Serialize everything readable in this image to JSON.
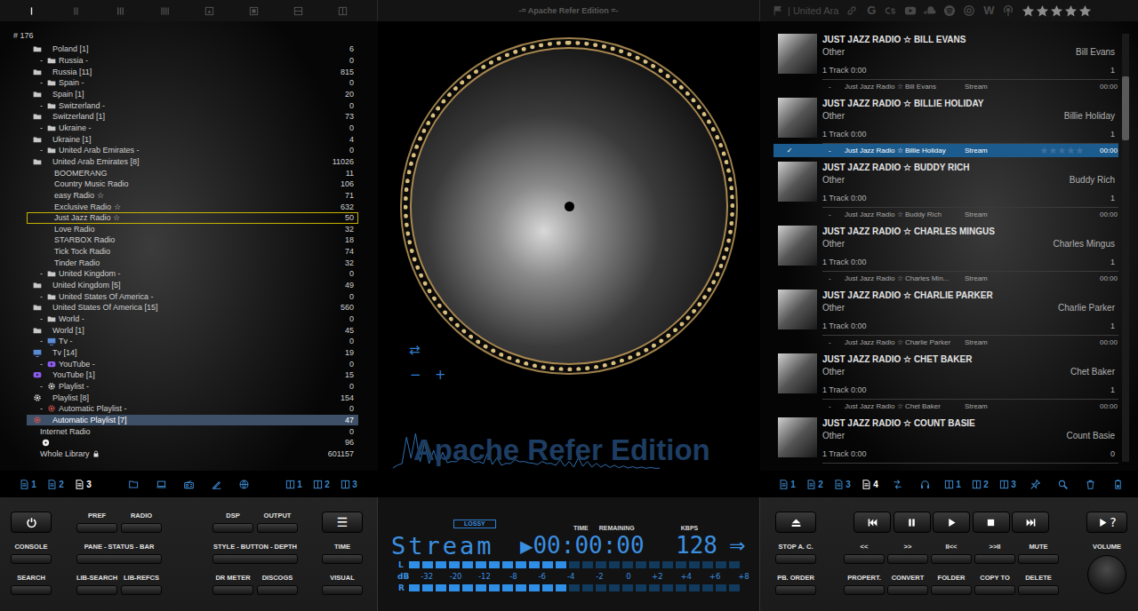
{
  "window": {
    "title": "-= Apache Refer Edition =-"
  },
  "top_bar": {
    "layouts": [
      {
        "selected": true
      },
      {
        "selected": false
      },
      {
        "selected": false
      },
      {
        "selected": false
      },
      {
        "selected": false
      },
      {
        "selected": false
      },
      {
        "selected": false
      },
      {
        "selected": false
      }
    ],
    "location": "| United Ara",
    "google": "G",
    "wiki": "W",
    "rating": {
      "stars": 0
    }
  },
  "library": {
    "header": "# 176",
    "rows": [
      {
        "label": "Poland [1]",
        "count": "6",
        "kind": "country",
        "nested": false,
        "selected": false,
        "focused": false
      },
      {
        "expander": "-",
        "label": "Russia -",
        "count": "0",
        "kind": "country",
        "nested": true,
        "selected": false,
        "focused": false
      },
      {
        "label": "Russia [11]",
        "count": "815",
        "kind": "country",
        "nested": false,
        "selected": false,
        "focused": false
      },
      {
        "expander": "-",
        "label": "Spain -",
        "count": "0",
        "kind": "country",
        "nested": true,
        "selected": false,
        "focused": false
      },
      {
        "label": "Spain [1]",
        "count": "20",
        "kind": "country",
        "nested": false,
        "selected": false,
        "focused": false
      },
      {
        "expander": "-",
        "label": "Switzerland -",
        "count": "0",
        "kind": "country",
        "nested": true,
        "selected": false,
        "focused": false
      },
      {
        "label": "Switzerland [1]",
        "count": "73",
        "kind": "country",
        "nested": false,
        "selected": false,
        "focused": false
      },
      {
        "expander": "-",
        "label": "Ukraine -",
        "count": "0",
        "kind": "country",
        "nested": true,
        "selected": false,
        "focused": false
      },
      {
        "label": "Ukraine [1]",
        "count": "4",
        "kind": "country",
        "nested": false,
        "selected": false,
        "focused": false
      },
      {
        "expander": "-",
        "label": "United Arab Emirates -",
        "count": "0",
        "kind": "country",
        "nested": true,
        "selected": false,
        "focused": false
      },
      {
        "label": "United Arab Emirates [8]",
        "count": "11026",
        "kind": "country",
        "nested": false,
        "selected": false,
        "focused": false
      },
      {
        "label": "BOOMERANG",
        "count": "11",
        "kind": "station",
        "nested": false,
        "selected": false,
        "focused": false
      },
      {
        "label": "Country Music Radio",
        "count": "106",
        "kind": "station",
        "nested": false,
        "selected": false,
        "focused": false
      },
      {
        "label": "easy Radio ☆",
        "count": "71",
        "kind": "station",
        "nested": false,
        "selected": false,
        "focused": false
      },
      {
        "label": "Exclusive Radio ☆",
        "count": "632",
        "kind": "station",
        "nested": false,
        "selected": false,
        "focused": false
      },
      {
        "label": "Just Jazz Radio ☆",
        "count": "50",
        "kind": "station",
        "nested": false,
        "selected": false,
        "focused": true
      },
      {
        "label": "Love Radio",
        "count": "32",
        "kind": "station",
        "nested": false,
        "selected": false,
        "focused": false
      },
      {
        "label": "STARBOX Radio",
        "count": "18",
        "kind": "station",
        "nested": false,
        "selected": false,
        "focused": false
      },
      {
        "label": "Tick Tock Radio",
        "count": "74",
        "kind": "station",
        "nested": false,
        "selected": false,
        "focused": false
      },
      {
        "label": "Tinder Radio",
        "count": "32",
        "kind": "station",
        "nested": false,
        "selected": false,
        "focused": false
      },
      {
        "expander": "-",
        "label": "United Kingdom -",
        "count": "0",
        "kind": "country",
        "nested": true,
        "selected": false,
        "focused": false
      },
      {
        "label": "United Kingdom [5]",
        "count": "49",
        "kind": "country",
        "nested": false,
        "selected": false,
        "focused": false
      },
      {
        "expander": "-",
        "label": "United States Of America -",
        "count": "0",
        "kind": "country",
        "nested": true,
        "selected": false,
        "focused": false
      },
      {
        "label": "United States Of America [15]",
        "count": "560",
        "kind": "country",
        "nested": false,
        "selected": false,
        "focused": false
      },
      {
        "expander": "-",
        "label": "World -",
        "count": "0",
        "kind": "country",
        "nested": true,
        "selected": false,
        "focused": false
      },
      {
        "label": "World [1]",
        "count": "45",
        "kind": "country",
        "nested": false,
        "selected": false,
        "focused": false
      },
      {
        "expander": "-",
        "label": "Tv -",
        "count": "0",
        "kind": "tv",
        "nested": true,
        "selected": false,
        "focused": false
      },
      {
        "label": "Tv [14]",
        "count": "19",
        "kind": "tv",
        "nested": false,
        "selected": false,
        "focused": false
      },
      {
        "expander": "-",
        "label": "YouTube -",
        "count": "0",
        "kind": "youtube",
        "nested": true,
        "selected": false,
        "focused": false
      },
      {
        "label": "YouTube [1]",
        "count": "15",
        "kind": "youtube",
        "nested": false,
        "selected": false,
        "focused": false
      },
      {
        "expander": "-",
        "label": "Playlist -",
        "count": "0",
        "kind": "playlist",
        "nested": true,
        "selected": false,
        "focused": false
      },
      {
        "label": "Playlist [8]",
        "count": "154",
        "kind": "playlist",
        "nested": false,
        "selected": false,
        "focused": false
      },
      {
        "expander": "-",
        "label": "Automatic Playlist -",
        "count": "0",
        "kind": "autoplaylist",
        "nested": true,
        "selected": false,
        "focused": false
      },
      {
        "label": "Automatic Playlist [7]",
        "count": "47",
        "kind": "autoplaylist",
        "nested": false,
        "selected": true,
        "focused": false
      },
      {
        "label": "Internet Radio",
        "count": "0",
        "kind": "source",
        "nested": false,
        "selected": false,
        "focused": false
      },
      {
        "count": "96",
        "kind": "disc",
        "nested": false,
        "selected": false,
        "focused": false
      },
      {
        "label": "Whole Library",
        "count": "601157",
        "kind": "source",
        "nested": false,
        "locked": true,
        "selected": false,
        "focused": false
      }
    ]
  },
  "cover": {
    "shuffle": "⇄",
    "minus": "−",
    "plus": "+"
  },
  "waveform": [
    0.05,
    0.1,
    0.3,
    0.85,
    0.6,
    0.95,
    0.4,
    0.7,
    0.3,
    0.5,
    0.25,
    0.45,
    0.35,
    0.2,
    0.4,
    0.3,
    0.55,
    0.25,
    0.35,
    0.2,
    0.3,
    0.45,
    0.25,
    0.3,
    0.2,
    0.15,
    0.3,
    0.25,
    0.4,
    0.2,
    0.35,
    0.15,
    0.25,
    0.2,
    0.3,
    0.15,
    0.2,
    0.25,
    0.15,
    0.2,
    0.1,
    0.3,
    0.15,
    0.2,
    0.1,
    0.15,
    0.1,
    0.12,
    0.08,
    0.1,
    0.06,
    0.08,
    0.05,
    0.06,
    0.04,
    0.05,
    0.03,
    0.04,
    0.03,
    0.02
  ],
  "brand": "Apache Refer Edition",
  "playlist": {
    "groups": [
      {
        "title": "JUST JAZZ RADIO ☆ BILL EVANS",
        "genre": "Other",
        "artist": "Bill Evans",
        "summary": "1 Track  0:00",
        "count": "1",
        "track": {
          "number": "-",
          "title": "Just Jazz Radio ☆ Bill Evans",
          "codec": "Stream",
          "time": "00:00",
          "selected": false
        }
      },
      {
        "title": "JUST JAZZ RADIO ☆ BILLIE HOLIDAY",
        "genre": "Other",
        "artist": "Billie Holiday",
        "summary": "1 Track  0:00",
        "count": "1",
        "track": {
          "check": "✓",
          "number": "-",
          "title": "Just Jazz Radio ☆ Billie Holiday",
          "codec": "Stream",
          "stars": 0,
          "time": "00:00",
          "selected": true
        }
      },
      {
        "title": "JUST JAZZ RADIO ☆ BUDDY RICH",
        "genre": "Other",
        "artist": "Buddy Rich",
        "summary": "1 Track  0:00",
        "count": "1",
        "track": {
          "number": "-",
          "title": "Just Jazz Radio ☆ Buddy Rich",
          "codec": "Stream",
          "time": "00:00",
          "selected": false
        }
      },
      {
        "title": "JUST JAZZ RADIO ☆ CHARLES MINGUS",
        "genre": "Other",
        "artist": "Charles Mingus",
        "summary": "1 Track  0:00",
        "count": "1",
        "track": {
          "number": "-",
          "title": "Just Jazz Radio ☆ Charles Min...",
          "codec": "Stream",
          "time": "00:00",
          "selected": false
        }
      },
      {
        "title": "JUST JAZZ RADIO ☆ CHARLIE PARKER",
        "genre": "Other",
        "artist": "Charlie Parker",
        "summary": "1 Track  0:00",
        "count": "1",
        "track": {
          "number": "-",
          "title": "Just Jazz Radio ☆ Charlie Parker",
          "codec": "Stream",
          "time": "00:00",
          "selected": false
        }
      },
      {
        "title": "JUST JAZZ RADIO ☆ CHET BAKER",
        "genre": "Other",
        "artist": "Chet Baker",
        "summary": "1 Track  0:00",
        "count": "1",
        "track": {
          "number": "-",
          "title": "Just Jazz Radio ☆ Chet Baker",
          "codec": "Stream",
          "time": "00:00",
          "selected": false
        }
      },
      {
        "title": "JUST JAZZ RADIO ☆ COUNT BASIE",
        "genre": "Other",
        "artist": "Count Basie",
        "summary": "1 Track  0:00",
        "count": "0"
      }
    ],
    "scrollbar": {
      "position": 0.1,
      "size": 0.15
    }
  },
  "left_strip": {
    "pages": [
      {
        "label": "1",
        "selected": false
      },
      {
        "label": "2",
        "selected": false
      },
      {
        "label": "3",
        "selected": true
      }
    ],
    "views": [
      {
        "label": "1",
        "selected": false
      },
      {
        "label": "2",
        "selected": false
      },
      {
        "label": "3",
        "selected": false
      }
    ]
  },
  "right_strip": {
    "pages": [
      {
        "label": "1",
        "selected": false
      },
      {
        "label": "2",
        "selected": false
      },
      {
        "label": "3",
        "selected": false
      },
      {
        "label": "4",
        "selected": true
      }
    ],
    "views": [
      {
        "label": "1",
        "selected": false
      },
      {
        "label": "2",
        "selected": false
      },
      {
        "label": "3",
        "selected": false
      }
    ]
  },
  "controls": {
    "left": {
      "a": [
        "CONSOLE",
        "SEARCH"
      ],
      "b": [
        [
          "PREF",
          "RADIO"
        ],
        [
          "PANE - STATUS - BAR"
        ],
        [
          "LIB-SEARCH",
          "LIB-REFCS"
        ]
      ],
      "c": [
        [
          "DSP",
          "OUTPUT"
        ],
        [
          "STYLE - BUTTON - DEPTH"
        ],
        [
          "DR METER",
          "DISCOGS"
        ]
      ],
      "menu": "☰",
      "d": [
        "TIME",
        "VISUAL"
      ]
    },
    "display": {
      "format": "LOSSY",
      "time_label": "TIME",
      "remaining_label": "REMAINING",
      "kbps_label": "KBPS",
      "codec": "Stream",
      "state": "▶",
      "time": "00:00:00",
      "bitrate": "128",
      "arrow": "⇒",
      "left_label": "L",
      "right_label": "R",
      "db_label": "dB",
      "scale": [
        "-32",
        "-20",
        "-12",
        "-8",
        "-6",
        "-4",
        "-2",
        "0",
        "+2",
        "+4",
        "+6",
        "+8"
      ],
      "left": {
        "level": 0.48
      },
      "right": {
        "level": 0.48
      }
    },
    "right": {
      "e": [
        "STOP A. C.",
        "PB. ORDER"
      ],
      "row2": [
        "<<",
        ">>",
        "II<<",
        ">>II",
        "MUTE"
      ],
      "row3": [
        "PROPERT.",
        "CONVERT",
        "FOLDER",
        "COPY TO",
        "DELETE"
      ],
      "help": "?",
      "volume_label": "VOLUME"
    }
  }
}
